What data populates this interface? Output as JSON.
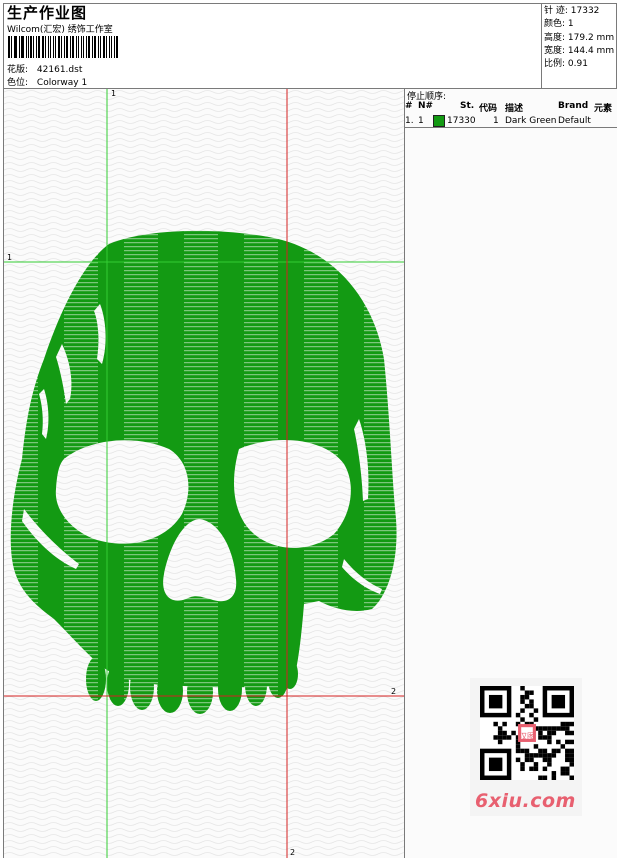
{
  "header": {
    "title": "生产作业图",
    "company": "Wilcom(汇宏) 绣饰工作室",
    "design_label": "花版:",
    "design_value": "42161.dst",
    "colorway_label": "色位:",
    "colorway_value": "Colorway 1"
  },
  "stats": {
    "stitches_label": "针 迹:",
    "stitches_value": "17332",
    "colors_label": "颜色:",
    "colors_value": "1",
    "height_label": "高度:",
    "height_value": "179.2 mm",
    "width_label": "宽度:",
    "width_value": "144.4 mm",
    "scale_label": "比例:",
    "scale_value": "0.91"
  },
  "stop_sequence": {
    "title": "停止顺序:",
    "columns": [
      "#",
      "N#",
      "St.",
      "代码",
      "描述",
      "Brand",
      "元素"
    ],
    "rows": [
      {
        "num": "1.",
        "needle": "1",
        "stitches": "17330",
        "code": "1",
        "description": "Dark Green",
        "brand": "Default",
        "color": "#139a13"
      }
    ]
  },
  "guides": {
    "green_top": "1",
    "green_left": "1",
    "red_right": "2",
    "red_bottom": "2"
  },
  "colors": {
    "thread": "#139a13",
    "guide_green": "#33cc33",
    "guide_red": "#d42020"
  },
  "watermark": {
    "site": "6xiu.com",
    "stamp": "汉图"
  }
}
